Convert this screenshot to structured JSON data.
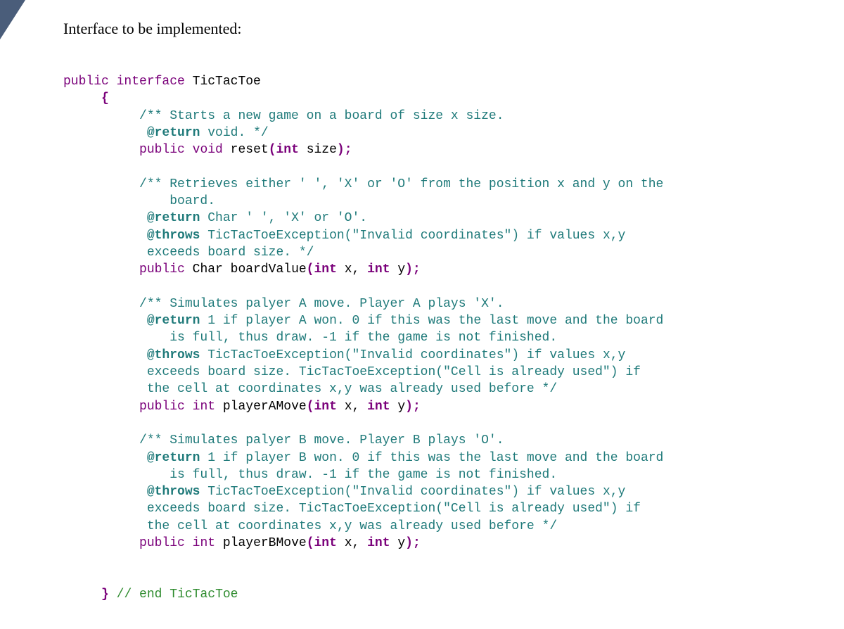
{
  "header": "Interface to be implemented:",
  "code": {
    "l01a": "public",
    "l01b": " ",
    "l01c": "interface",
    "l01d": " TicTacToe",
    "l02": "     {",
    "l03": "          /** Starts a new game on a board of size x size.",
    "l04a": "           ",
    "l04b": "@return",
    "l04c": " void. */",
    "l05a": "          ",
    "l05b": "public",
    "l05c": " ",
    "l05d": "void",
    "l05e": " reset",
    "l05f": "(int",
    "l05g": " size",
    "l05h": ");",
    "l07": "          /** Retrieves either ' ', 'X' or 'O' from the position x and y on the",
    "l08": "              board.",
    "l09a": "           ",
    "l09b": "@return",
    "l09c": " Char ' ', 'X' or 'O'.",
    "l10a": "           ",
    "l10b": "@throws",
    "l10c": " TicTacToeException(\"Invalid coordinates\") if values x,y",
    "l11": "           exceeds board size. */",
    "l12a": "          ",
    "l12b": "public",
    "l12c": " Char boardValue",
    "l12d": "(int",
    "l12e": " x, ",
    "l12f": "int",
    "l12g": " y",
    "l12h": ");",
    "l14": "          /** Simulates palyer A move. Player A plays 'X'.",
    "l15a": "           ",
    "l15b": "@return",
    "l15c": " 1 if player A won. 0 if this was the last move and the board",
    "l16": "              is full, thus draw. -1 if the game is not finished.",
    "l17a": "           ",
    "l17b": "@throws",
    "l17c": " TicTacToeException(\"Invalid coordinates\") if values x,y",
    "l18": "           exceeds board size. TicTacToeException(\"Cell is already used\") if",
    "l19": "           the cell at coordinates x,y was already used before */",
    "l20a": "          ",
    "l20b": "public",
    "l20c": " ",
    "l20d": "int",
    "l20e": " playerAMove",
    "l20f": "(int",
    "l20g": " x, ",
    "l20h": "int",
    "l20i": " y",
    "l20j": ");",
    "l22": "          /** Simulates palyer B move. Player B plays 'O'.",
    "l23a": "           ",
    "l23b": "@return",
    "l23c": " 1 if player B won. 0 if this was the last move and the board",
    "l24": "              is full, thus draw. -1 if the game is not finished.",
    "l25a": "           ",
    "l25b": "@throws",
    "l25c": " TicTacToeException(\"Invalid coordinates\") if values x,y",
    "l26": "           exceeds board size. TicTacToeException(\"Cell is already used\") if",
    "l27": "           the cell at coordinates x,y was already used before */",
    "l28a": "          ",
    "l28b": "public",
    "l28c": " ",
    "l28d": "int",
    "l28e": " playerBMove",
    "l28f": "(int",
    "l28g": " x, ",
    "l28h": "int",
    "l28i": " y",
    "l28j": ");",
    "l31a": "     ",
    "l31b": "}",
    "l31c": " ",
    "l31d": "// end TicTacToe"
  }
}
